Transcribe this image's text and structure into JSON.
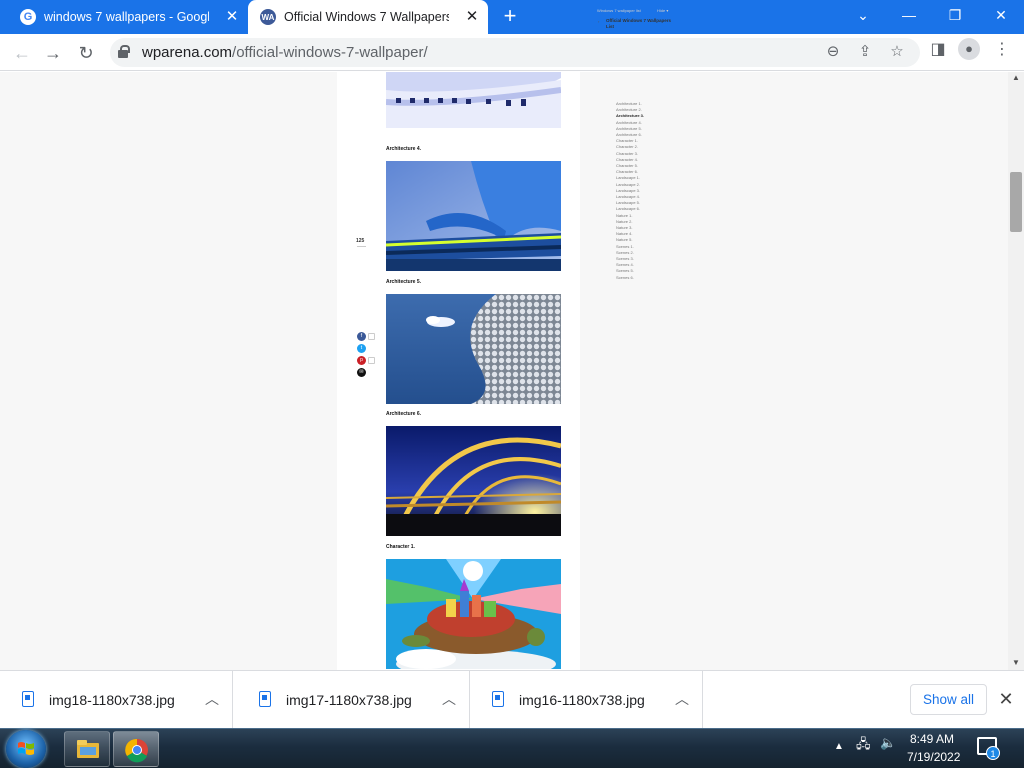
{
  "browser": {
    "tabs": [
      {
        "title": "windows 7 wallpapers - Google S",
        "favicon": "google-icon",
        "active": false
      },
      {
        "title": "Official Windows 7 Wallpapers -",
        "favicon": "wparena-icon",
        "favicon_text": "WA",
        "active": true
      }
    ],
    "new_tab": "+",
    "url_domain": "wparena.com",
    "url_path": "/official-windows-7-wallpaper/",
    "accent_color": "#1a73e8"
  },
  "article": {
    "sections": [
      {
        "caption": "Architecture 4.",
        "image": "blue-sweeping-wall-architecture"
      },
      {
        "caption": "Architecture 5.",
        "image": "silver-dotted-dome-building"
      },
      {
        "caption": "Architecture 6.",
        "image": "yellow-arched-tunnel-sunset"
      },
      {
        "caption": "Character 1.",
        "image": "colorful-turtle-city-illustration"
      }
    ],
    "share": {
      "count": "125"
    }
  },
  "toc": {
    "faded_left": "Windows 7 wallpaper list",
    "faded_right": "Hide ▾",
    "title": "Official Windows 7 Wallpapers List",
    "items": [
      "Architecture 1.",
      "Architecture 2.",
      "Architecture 3.",
      "Architecture 4.",
      "Architecture 5.",
      "Architecture 6.",
      "Character 1.",
      "Character 2.",
      "Character 3.",
      "Character 4.",
      "Character 5.",
      "Character 6.",
      "Landscape 1.",
      "Landscape 2.",
      "Landscape 3.",
      "Landscape 4.",
      "Landscape 5.",
      "Landscape 6.",
      "Nature 1.",
      "Nature 2.",
      "Nature 3.",
      "Nature 4.",
      "Nature 5.",
      "Scenes 1.",
      "Scenes 2.",
      "Scenes 3.",
      "Scenes 4.",
      "Scenes 5.",
      "Scenes 6."
    ],
    "active_index": 2
  },
  "downloads": {
    "items": [
      {
        "name": "img18-1180x738.jpg"
      },
      {
        "name": "img17-1180x738.jpg"
      },
      {
        "name": "img16-1180x738.jpg"
      }
    ],
    "show_all": "Show all"
  },
  "taskbar": {
    "time": "8:49 AM",
    "date": "7/19/2022",
    "notification_count": "1"
  }
}
